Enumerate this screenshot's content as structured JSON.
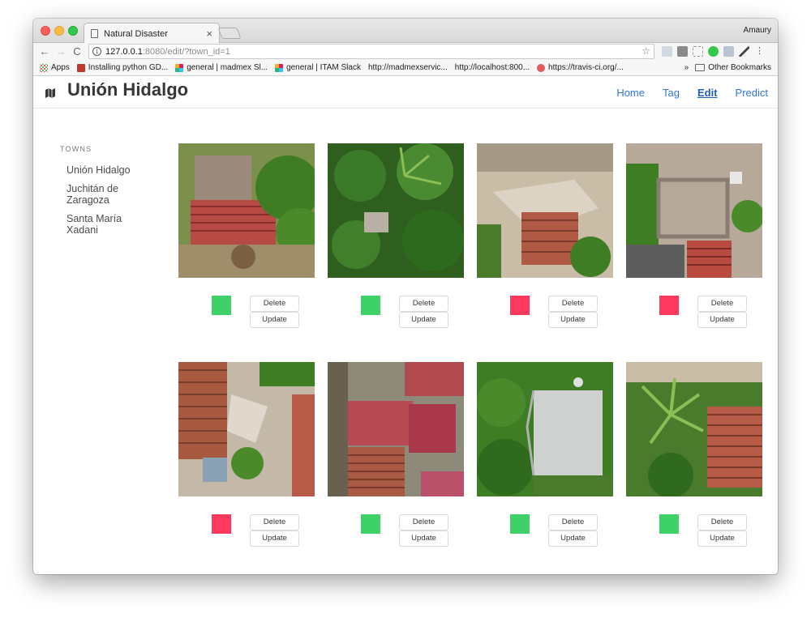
{
  "browser": {
    "tab_title": "Natural Disaster",
    "tab_close": "×",
    "profile_name": "Amaury",
    "url_host": "127.0.0.1",
    "url_rest": ":8080/edit/?town_id=1",
    "bookmarks": [
      {
        "label": "Apps",
        "icon": "apps-icon"
      },
      {
        "label": "Installing python GD...",
        "icon": "bookmark-favicon"
      },
      {
        "label": "general | madmex Sl...",
        "icon": "slack-icon"
      },
      {
        "label": "general | ITAM Slack",
        "icon": "slack-icon"
      },
      {
        "label": "http://madmexservic...",
        "icon": "page-icon"
      },
      {
        "label": "http://localhost:800...",
        "icon": "page-icon"
      },
      {
        "label": "https://travis-ci.org/...",
        "icon": "travis-icon"
      }
    ],
    "bookmarks_overflow": "»",
    "other_bookmarks": "Other Bookmarks"
  },
  "navbar": {
    "brand": "Unión Hidalgo",
    "menu": [
      "Home",
      "Tag",
      "Edit",
      "Predict"
    ],
    "active": "Edit"
  },
  "sidebar": {
    "heading": "TOWNS",
    "towns": [
      "Unión Hidalgo",
      "Juchitán de Zaragoza",
      "Santa María Xadani"
    ]
  },
  "colors": {
    "status_green": "#3dd168",
    "status_red": "#ff3860",
    "link": "#3273dc"
  },
  "buttons": {
    "delete": "Delete",
    "update": "Update"
  },
  "images": [
    {
      "status": "green",
      "scene": "red-tile-roof-with-tree"
    },
    {
      "status": "green",
      "scene": "dense-vegetation"
    },
    {
      "status": "red",
      "scene": "collapsed-building-rubble"
    },
    {
      "status": "red",
      "scene": "damaged-house-walls"
    },
    {
      "status": "red",
      "scene": "collapsed-tile-roof-debris"
    },
    {
      "status": "green",
      "scene": "red-roofs-cluster"
    },
    {
      "status": "green",
      "scene": "gray-concrete-roof"
    },
    {
      "status": "green",
      "scene": "palm-and-tile-roof"
    }
  ]
}
